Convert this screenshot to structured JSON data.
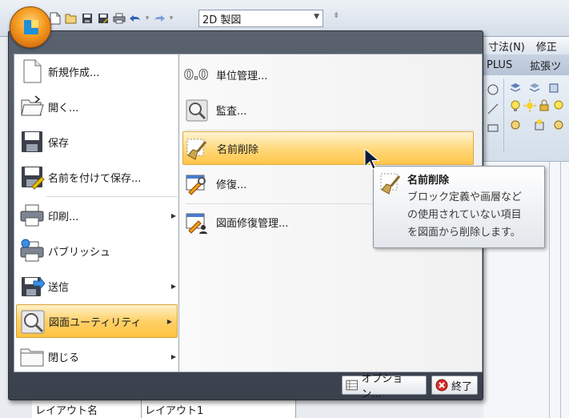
{
  "titlebar": {
    "workspace": "2D 製図"
  },
  "menubar": {
    "items": [
      "寸法(N)",
      "修正"
    ]
  },
  "ribbon": {
    "tabs": [
      "PLUS",
      "拡張ツ"
    ]
  },
  "app_menu": {
    "left_items": [
      {
        "label": "新規作成...",
        "icon": "new-document-icon",
        "has_submenu": false
      },
      {
        "label": "開く...",
        "icon": "open-folder-icon",
        "has_submenu": false
      },
      {
        "label": "保存",
        "icon": "save-icon",
        "has_submenu": false
      },
      {
        "label": "名前を付けて保存...",
        "icon": "save-as-icon",
        "has_submenu": false
      },
      {
        "label": "印刷...",
        "icon": "printer-icon",
        "has_submenu": true
      },
      {
        "label": "パブリッシュ",
        "icon": "publish-icon",
        "has_submenu": false
      },
      {
        "label": "送信",
        "icon": "send-icon",
        "has_submenu": true
      },
      {
        "label": "図面ユーティリティ",
        "icon": "drawing-utilities-icon",
        "has_submenu": true,
        "active": true
      },
      {
        "label": "閉じる",
        "icon": "close-folder-icon",
        "has_submenu": true
      }
    ],
    "right_items": [
      {
        "label": "単位管理...",
        "icon": "units-icon"
      },
      {
        "label": "監査...",
        "icon": "audit-icon"
      },
      {
        "label": "名前削除",
        "icon": "purge-icon",
        "active": true
      },
      {
        "label": "修復...",
        "icon": "recover-icon"
      },
      {
        "label": "図面修復管理...",
        "icon": "drawing-recovery-icon"
      }
    ],
    "units_glyph": "0.0",
    "footer": {
      "options_label": "オプション...",
      "exit_label": "終了"
    }
  },
  "tooltip": {
    "title": "名前削除",
    "lines": [
      "ブロック定義や画層など",
      "の使用されていない項目",
      "を図面から削除します。"
    ]
  },
  "bottom_grid": {
    "cells": [
      "レイアウト名",
      "レイアウト1"
    ]
  },
  "colors": {
    "highlight": "#ffc240",
    "menu_frame": "#3b414c",
    "app_button": "#f59a1e"
  }
}
